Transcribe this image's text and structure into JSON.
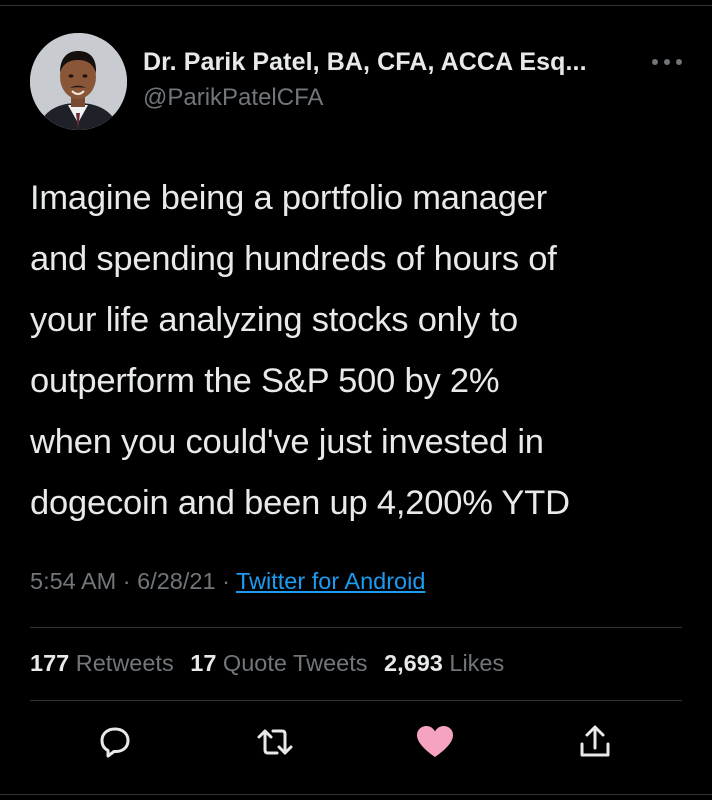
{
  "author": {
    "display_name": "Dr. Parik Patel, BA, CFA, ACCA Esq...",
    "handle": "@ParikPatelCFA",
    "avatar_icon": "profile-photo"
  },
  "tweet": {
    "text": "Imagine being a portfolio manager\nand spending hundreds of hours of\nyour life analyzing stocks only to\noutperform the S&P 500 by 2%\nwhen you could've just invested in\ndogecoin and been up 4,200% YTD",
    "time": "5:54 AM",
    "date": "6/28/21",
    "separator": "·",
    "source": "Twitter for Android"
  },
  "stats": {
    "retweets_count": "177",
    "retweets_label": "Retweets",
    "quotes_count": "17",
    "quotes_label": "Quote Tweets",
    "likes_count": "2,693",
    "likes_label": "Likes"
  },
  "actions": {
    "reply_icon": "reply-icon",
    "retweet_icon": "retweet-icon",
    "like_icon": "heart-icon",
    "share_icon": "share-icon",
    "like_color": "#f5a3c0"
  },
  "colors": {
    "background": "#000000",
    "primary_text": "#e7e9ea",
    "secondary_text": "#71767b",
    "link": "#1d9bf0"
  }
}
